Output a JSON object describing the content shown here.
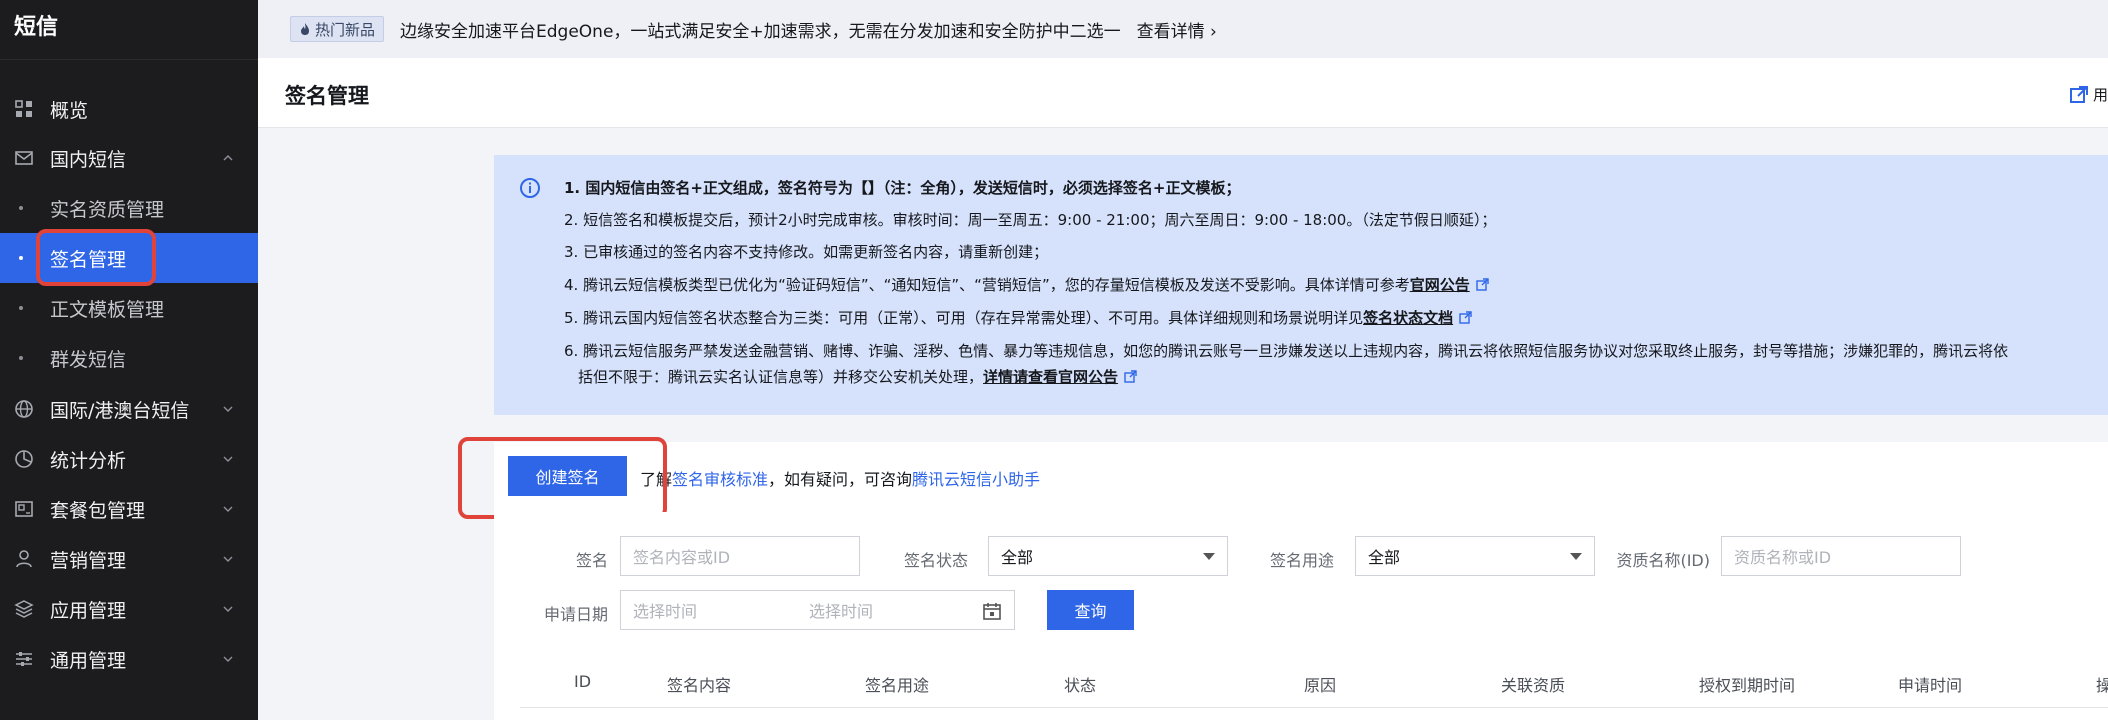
{
  "sidebar": {
    "title": "短信",
    "items": [
      {
        "label": "概览",
        "icon": "grid-icon",
        "expandable": false
      },
      {
        "label": "国内短信",
        "icon": "mail-icon",
        "expandable": true,
        "expanded": true
      },
      {
        "label": "国际/港澳台短信",
        "icon": "globe-icon",
        "expandable": true
      },
      {
        "label": "统计分析",
        "icon": "pie-chart-icon",
        "expandable": true
      },
      {
        "label": "套餐包管理",
        "icon": "package-icon",
        "expandable": true
      },
      {
        "label": "营销管理",
        "icon": "user-icon",
        "expandable": true
      },
      {
        "label": "应用管理",
        "icon": "layers-icon",
        "expandable": true
      },
      {
        "label": "通用管理",
        "icon": "sliders-icon",
        "expandable": true
      }
    ],
    "subitems": [
      {
        "label": "实名资质管理",
        "active": false
      },
      {
        "label": "签名管理",
        "active": true
      },
      {
        "label": "正文模板管理",
        "active": false
      },
      {
        "label": "群发短信",
        "active": false
      }
    ]
  },
  "banner": {
    "badge": "热门新品",
    "text": "边缘安全加速平台EdgeOne，一站式满足安全+加速需求，无需在分发加速和安全防护中二选一",
    "link": "查看详情 ›"
  },
  "header": {
    "title": "签名管理",
    "right_link": "用"
  },
  "notice": {
    "lines": [
      {
        "text": "1. 国内短信由签名+正文组成，签名符号为【】（注：全角），发送短信时，必须选择签名+正文模板；",
        "link": ""
      },
      {
        "text": "2. 短信签名和模板提交后，预计2小时完成审核。审核时间：周一至周五：9:00 - 21:00；周六至周日：9:00 - 18:00。（法定节假日顺延）；",
        "link": ""
      },
      {
        "text": "3. 已审核通过的签名内容不支持修改。如需更新签名内容，请重新创建；",
        "link": ""
      },
      {
        "text": "4. 腾讯云短信模板类型已优化为“验证码短信”、“通知短信”、“营销短信”，您的存量短信模板及发送不受影响。具体详情可参考",
        "link": "官网公告"
      },
      {
        "text": "5. 腾讯云国内短信签名状态整合为三类：可用（正常）、可用（存在异常需处理）、不可用。具体详细规则和场景说明详见",
        "link": "签名状态文档"
      },
      {
        "text": "6. 腾讯云短信服务严禁发送金融营销、赌博、诈骗、淫秽、色情、暴力等违规信息，如您的腾讯云账号一旦涉嫌发送以上违规内容，腾讯云将依照短信服务协议对您采取终止服务，封号等措施；涉嫌犯罪的，腾讯云将依",
        "link": ""
      },
      {
        "text": "括但不限于：腾讯云实名认证信息等）并移交公安机关处理，",
        "link": "详情请查看官网公告"
      }
    ]
  },
  "actions": {
    "create_label": "创建签名",
    "text_prefix": "了解",
    "link1": "签名审核标准",
    "text_mid": "，如有疑问，可咨询",
    "link2": "腾讯云短信小助手"
  },
  "filters": {
    "sign_label": "签名",
    "sign_placeholder": "签名内容或ID",
    "status_label": "签名状态",
    "status_value": "全部",
    "usage_label": "签名用途",
    "usage_value": "全部",
    "qual_label": "资质名称(ID)",
    "qual_placeholder": "资质名称或ID",
    "date_label": "申请日期",
    "start_placeholder": "选择时间",
    "end_placeholder": "选择时间",
    "query_label": "查询"
  },
  "table": {
    "columns": [
      "ID",
      "签名内容",
      "签名用途",
      "状态",
      "原因",
      "关联资质",
      "授权到期时间",
      "申请时间",
      "操"
    ]
  },
  "colors": {
    "primary": "#2f66e8",
    "sidebar_bg": "#1c1c1f",
    "notice_bg": "#d6e2fb",
    "highlight": "#e0433a"
  }
}
